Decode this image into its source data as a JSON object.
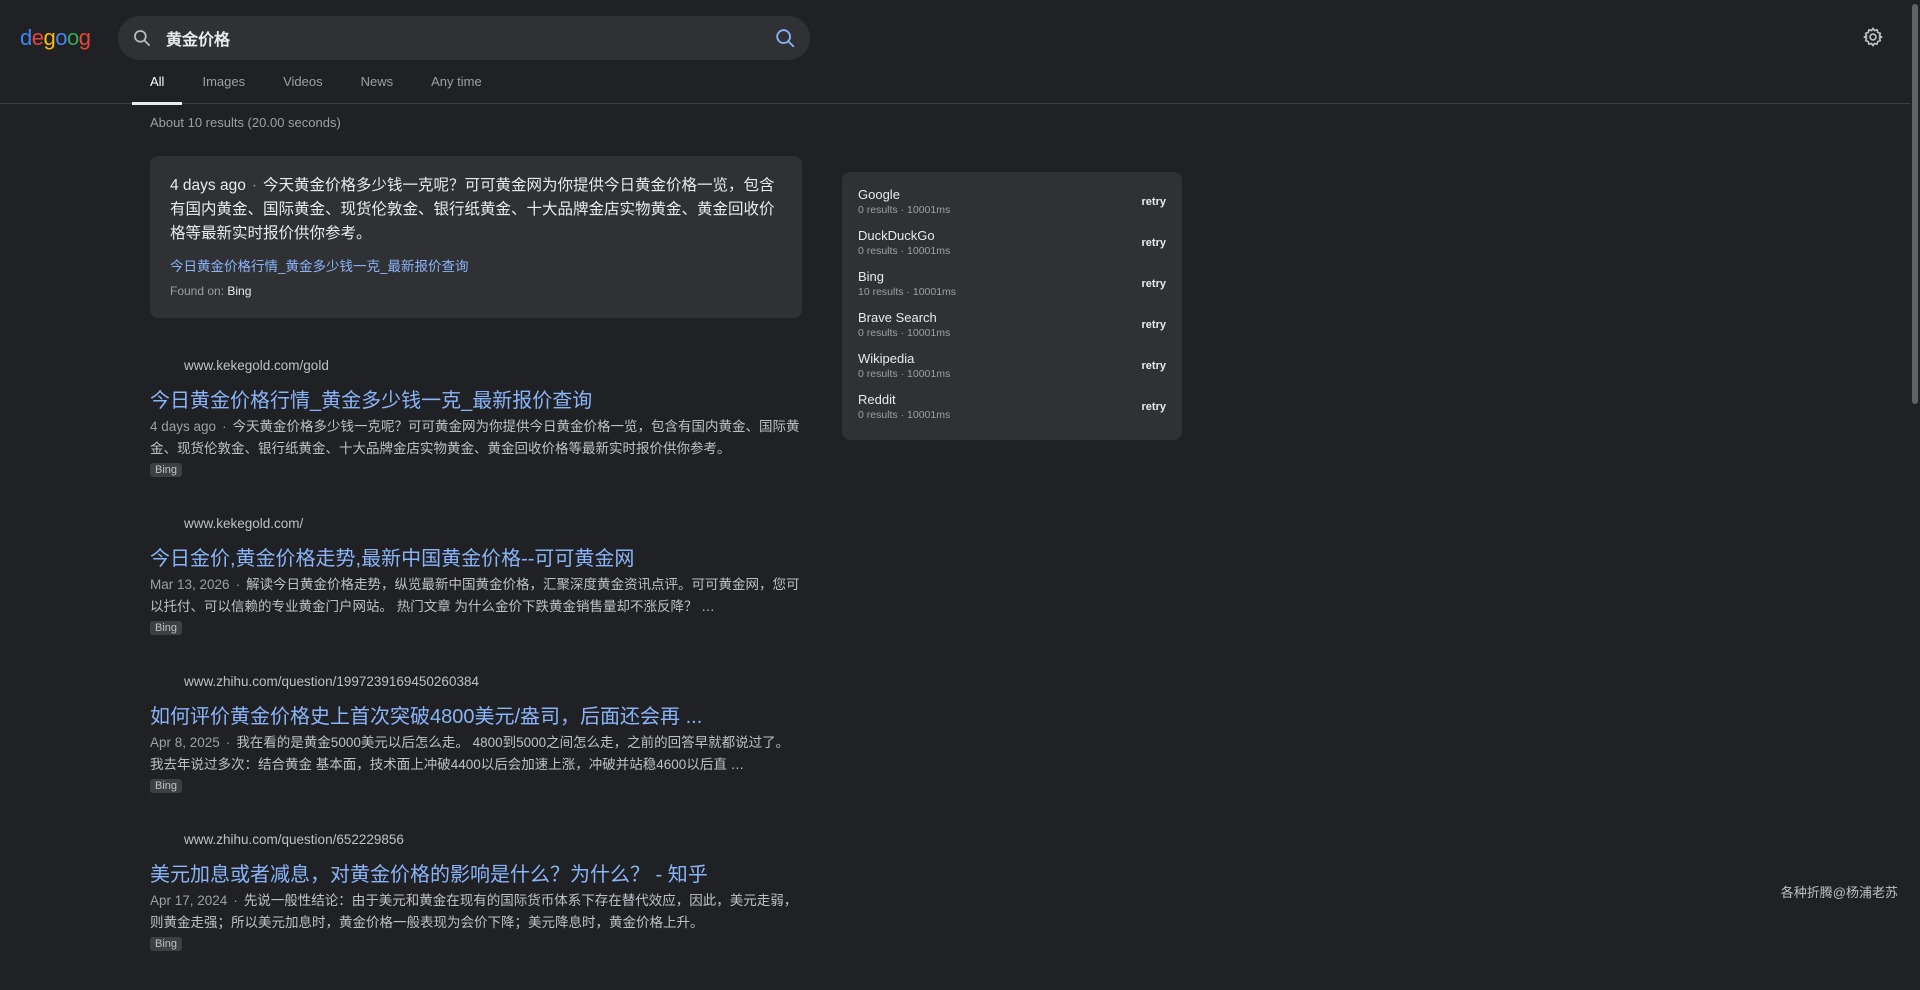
{
  "logo": {
    "letters": [
      "d",
      "e",
      "g",
      "o",
      "o",
      "g"
    ],
    "colors": [
      "#4285f4",
      "#ea4335",
      "#fbbc05",
      "#4285f4",
      "#34a853",
      "#ea4335"
    ]
  },
  "search": {
    "query": "黄金价格"
  },
  "tabs": [
    {
      "label": "All",
      "active": true
    },
    {
      "label": "Images",
      "active": false
    },
    {
      "label": "Videos",
      "active": false
    },
    {
      "label": "News",
      "active": false
    },
    {
      "label": "Any time",
      "active": false
    }
  ],
  "stats": "About 10 results (20.00 seconds)",
  "featured": {
    "date": "4 days ago",
    "separator": "·",
    "snippet": "今天黄金价格多少钱一克呢？可可黄金网为你提供今日黄金价格一览，包含有国内黄金、国际黄金、现货伦敦金、银行纸黄金、十大品牌金店实物黄金、黄金回收价格等最新实时报价供你参考。",
    "link": "今日黄金价格行情_黄金多少钱一克_最新报价查询",
    "found_label": "Found on:",
    "found_engine": "Bing"
  },
  "results": [
    {
      "url": "www.kekegold.com/gold",
      "title": "今日黄金价格行情_黄金多少钱一克_最新报价查询",
      "date": "4 days ago",
      "separator": "·",
      "snippet": "今天黄金价格多少钱一克呢？可可黄金网为你提供今日黄金价格一览，包含有国内黄金、国际黄金、现货伦敦金、银行纸黄金、十大品牌金店实物黄金、黄金回收价格等最新实时报价供你参考。",
      "badge": "Bing"
    },
    {
      "url": "www.kekegold.com/",
      "title": "今日金价,黄金价格走势,最新中国黄金价格--可可黄金网",
      "date": "Mar 13, 2026",
      "separator": "·",
      "snippet": "解读今日黄金价格走势，纵览最新中国黄金价格，汇聚深度黄金资讯点评。可可黄金网，您可以托付、可以信赖的专业黄金门户网站。 热门文章 为什么金价下跌黄金销售量却不涨反降？ …",
      "badge": "Bing"
    },
    {
      "url": "www.zhihu.com/question/1997239169450260384",
      "title": "如何评价黄金价格史上首次突破4800美元/盎司，后面还会再 ...",
      "date": "Apr 8, 2025",
      "separator": "·",
      "snippet": "我在看的是黄金5000美元以后怎么走。 4800到5000之间怎么走，之前的回答早就都说过了。 我去年说过多次：结合黄金 基本面，技术面上冲破4400以后会加速上涨，冲破并站稳4600以后直 …",
      "badge": "Bing"
    },
    {
      "url": "www.zhihu.com/question/652229856",
      "title": "美元加息或者减息，对黄金价格的影响是什么？为什么？ - 知乎",
      "date": "Apr 17, 2024",
      "separator": "·",
      "snippet": "先说一般性结论：由于美元和黄金在现有的国际货币体系下存在替代效应，因此，美元走弱，则黄金走强；所以美元加息时，黄金价格一般表现为会价下降；美元降息时，黄金价格上升。",
      "badge": "Bing"
    }
  ],
  "engines": [
    {
      "name": "Google",
      "meta": "0 results · 10001ms",
      "action": "retry"
    },
    {
      "name": "DuckDuckGo",
      "meta": "0 results · 10001ms",
      "action": "retry"
    },
    {
      "name": "Bing",
      "meta": "10 results · 10001ms",
      "action": "retry"
    },
    {
      "name": "Brave Search",
      "meta": "0 results · 10001ms",
      "action": "retry"
    },
    {
      "name": "Wikipedia",
      "meta": "0 results · 10001ms",
      "action": "retry"
    },
    {
      "name": "Reddit",
      "meta": "0 results · 10001ms",
      "action": "retry"
    }
  ],
  "icons": {
    "search_left": "search-icon",
    "search_button": "search-icon",
    "settings": "gear-icon"
  },
  "colors": {
    "background": "#202124",
    "panel": "#303134",
    "link": "#8ab4f8",
    "search_button_icon": "#8ab4f8"
  },
  "watermark": "各种折腾@杨浦老苏"
}
